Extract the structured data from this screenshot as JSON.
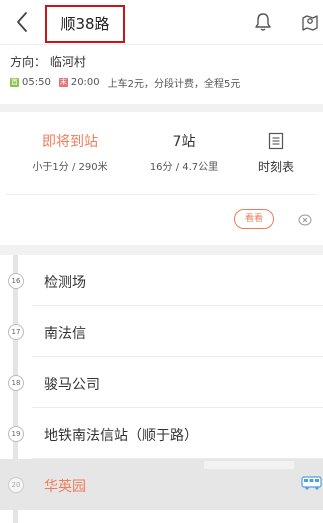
{
  "header": {
    "title": "顺38路"
  },
  "info": {
    "direction": "方向：  临河村",
    "first_badge": "首",
    "first_time": "05:50",
    "last_badge": "末",
    "last_time": "20:00",
    "fare": "上车2元，分段计费，全程5元"
  },
  "card": {
    "arrival": "即将到站",
    "arrival_sub": "小于1分 / 290米",
    "stops_count": "7站",
    "stops_sub": "16分 / 4.7公里",
    "schedule_label": "时刻表",
    "look_label": "看看"
  },
  "stops": [
    {
      "num": "16",
      "name": "检测场"
    },
    {
      "num": "17",
      "name": "南法信"
    },
    {
      "num": "18",
      "name": "骏马公司"
    },
    {
      "num": "19",
      "name": "地铁南法信站（顺于路）"
    },
    {
      "num": "20",
      "name": "华英园"
    }
  ],
  "colors": {
    "accent": "#f07c5a",
    "highlight_box": "#c8151b",
    "first_tag": "#8bc34a",
    "last_tag": "#e57373",
    "bus_icon": "#4aa3df"
  }
}
